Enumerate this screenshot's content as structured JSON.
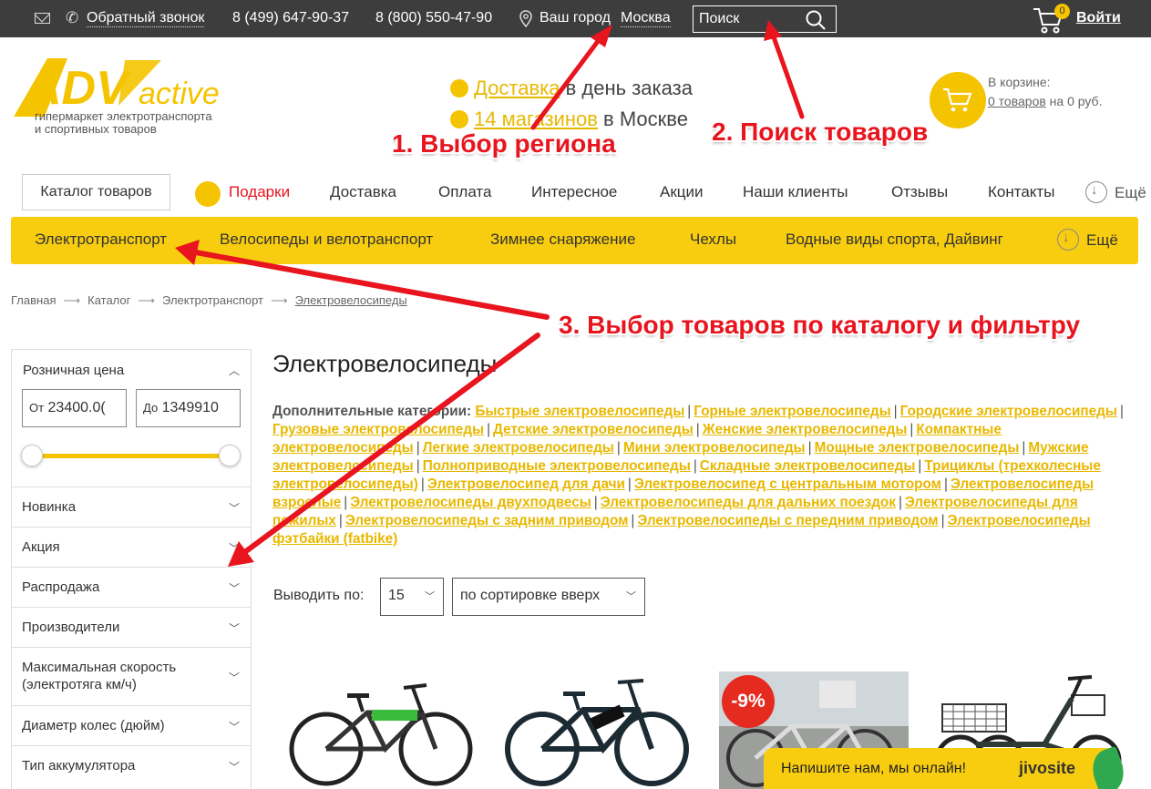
{
  "topbar": {
    "callback": "Обратный звонок",
    "phone1": "8 (499) 647-90-37",
    "phone2": "8 (800) 550-47-90",
    "city_label": "Ваш город",
    "city": "Москва",
    "search_placeholder": "Поиск",
    "cart_count": "0",
    "login": "Войти"
  },
  "header": {
    "logo_adv": "ADV",
    "logo_active": "active",
    "logo_sub": "гипермаркет электротранспорта\nи спортивных товаров",
    "delivery_link": "Доставка",
    "delivery_text": " в день заказа",
    "stores_link": "14 магазинов",
    "stores_text": " в Москве",
    "cart_label": "В корзине:",
    "cart_items": "0 товаров",
    "cart_sum": " на 0 руб."
  },
  "mainnav": {
    "catalog": "Каталог товаров",
    "items": [
      "Подарки",
      "Доставка",
      "Оплата",
      "Интересное",
      "Акции",
      "Наши клиенты",
      "Отзывы",
      "Контакты"
    ],
    "more": "Ещё"
  },
  "categories": {
    "items": [
      "Электротранспорт",
      "Велосипеды и велотранспорт",
      "Зимнее снаряжение",
      "Чехлы",
      "Водные виды спорта, Дайвинг"
    ],
    "more": "Ещё"
  },
  "breadcrumb": [
    "Главная",
    "Каталог",
    "Электротранспорт",
    "Электровелосипеды"
  ],
  "filter": {
    "price_title": "Розничная цена",
    "from_label": "От",
    "from_value": "23400.0(",
    "to_label": "До",
    "to_value": "1349910",
    "sections": [
      "Новинка",
      "Акция",
      "Распродажа",
      "Производители",
      "Максимальная скорость (электротяга км/ч)",
      "Диаметр колес (дюйм)",
      "Тип аккумулятора"
    ]
  },
  "content": {
    "title": "Электровелосипеды",
    "extra_label": "Дополнительные категории:",
    "extra_links": [
      "Быстрые электровелосипеды",
      "Горные электровелосипеды",
      "Городские электровелосипеды",
      "Грузовые электровелосипеды",
      "Детские электровелосипеды",
      "Женские электровелосипеды",
      "Компактные электровелосипеды",
      "Легкие электровелосипеды",
      "Мини электровелосипеды",
      "Мощные электровелосипеды",
      "Мужские электровелосипеды",
      "Полноприводные электровелосипеды",
      "Складные электровелосипеды",
      "Трициклы (трехколесные электровелосипеды)",
      "Электровелосипед для дачи",
      "Электровелосипед с центральным мотором",
      "Электровелосипеды взрослые",
      "Электровелосипеды двухподвесы",
      "Электровелосипеды для дальних поездок",
      "Электровелосипеды для пожилых",
      "Электровелосипеды с задним приводом",
      "Электровелосипеды с передним приводом",
      "Электровелосипеды фэтбайки (fatbike)"
    ],
    "perpage_label": "Выводить по:",
    "perpage_value": "15",
    "sort_value": "по сортировке вверх",
    "discount_badge": "-9%"
  },
  "chat": {
    "text": "Напишите нам, мы онлайн!",
    "brand": "jivosite"
  },
  "annotations": {
    "a1": "1. Выбор региона",
    "a2": "2. Поиск товаров",
    "a3": "3. Выбор товаров по каталогу и фильтру"
  },
  "colors": {
    "accent_yellow": "#f8cd0f",
    "link_yellow": "#e8b800",
    "annotation_red": "#e8141e",
    "topbar_bg": "#3d3d3d"
  }
}
